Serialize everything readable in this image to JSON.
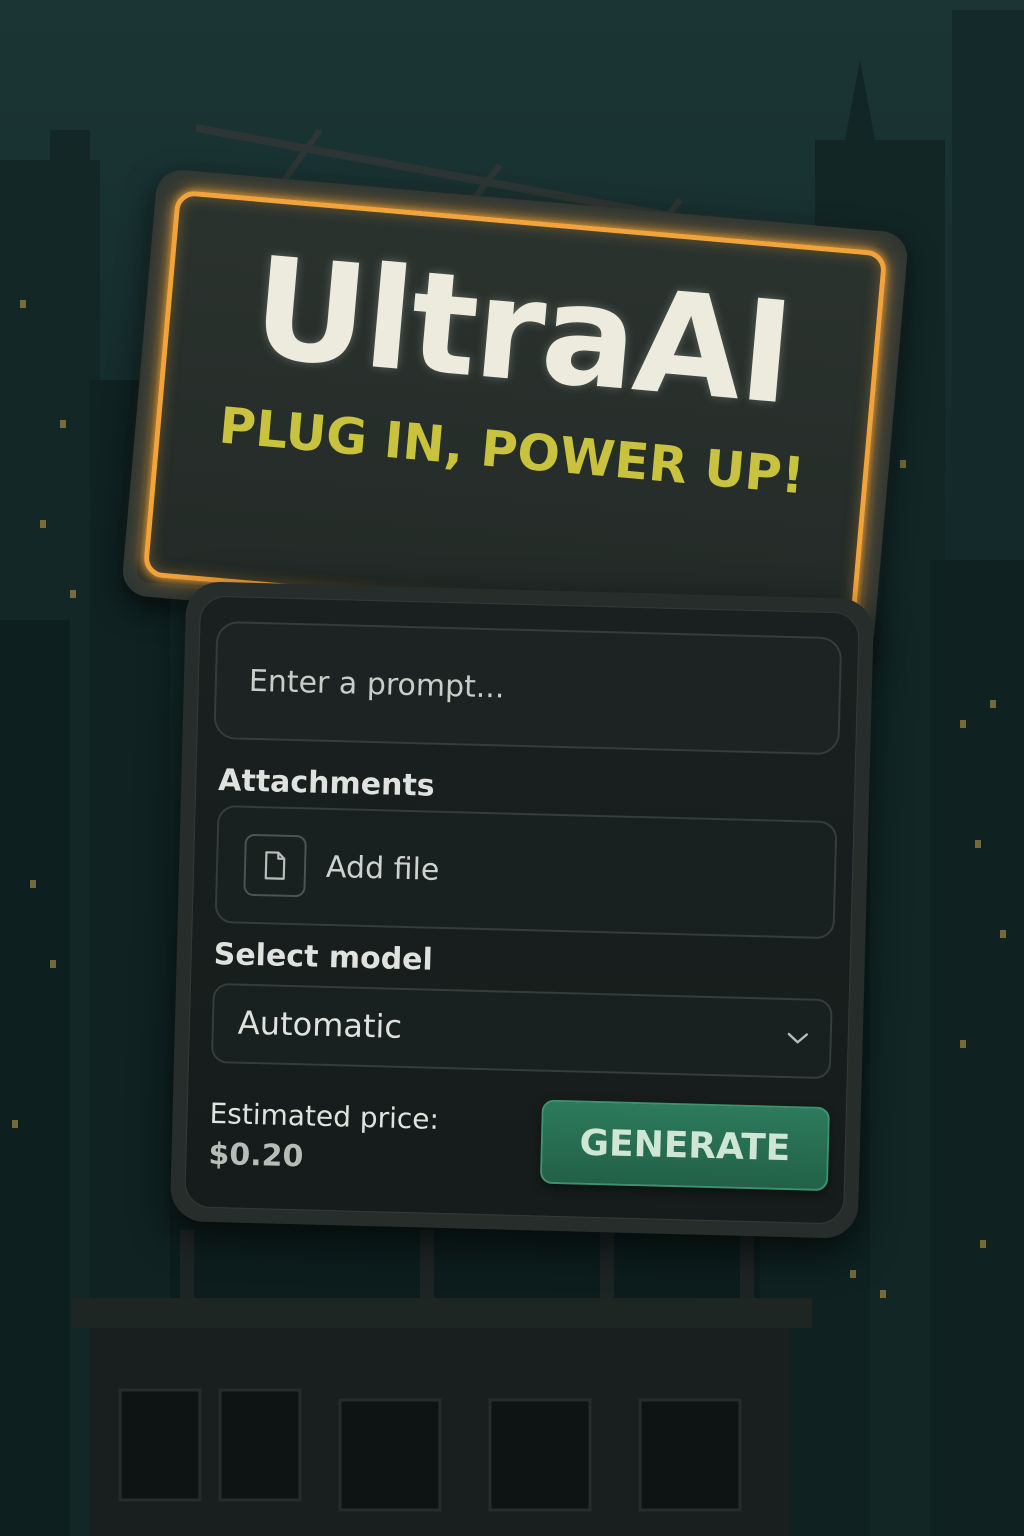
{
  "billboard": {
    "title": "UltraAI",
    "tagline": "PLUG IN, POWER UP!"
  },
  "form": {
    "prompt_placeholder": "Enter a prompt...",
    "attachments_label": "Attachments",
    "add_file_label": "Add file",
    "select_model_label": "Select model",
    "model_value": "Automatic",
    "price_label": "Estimated price:",
    "price_value": "$0.20",
    "generate_label": "GENERATE"
  },
  "icons": {
    "file": "file-icon",
    "chevron": "chevron-down-icon"
  },
  "colors": {
    "neon_border": "#f2a33a",
    "tagline": "#c8c23e",
    "generate_button": "#2d7a5d"
  }
}
